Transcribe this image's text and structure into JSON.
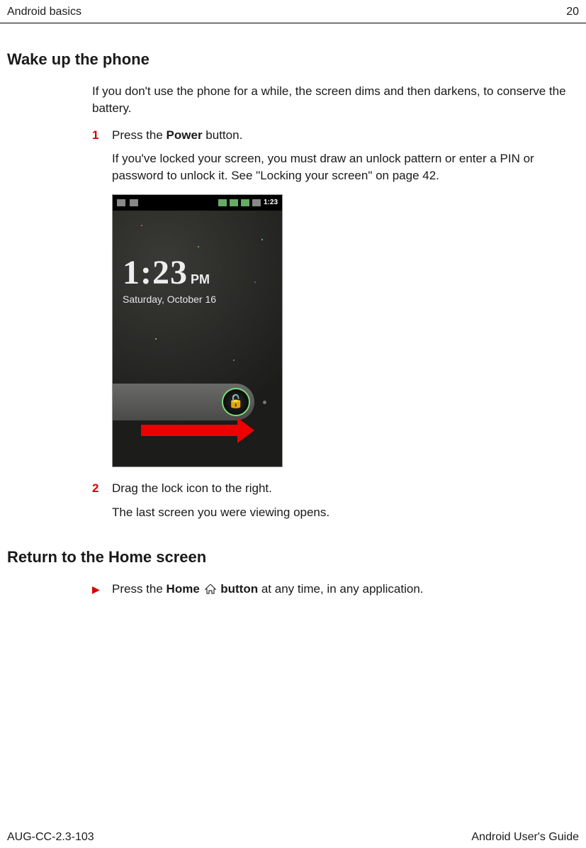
{
  "header": {
    "left": "Android basics",
    "right": "20"
  },
  "section1": {
    "title": "Wake up the phone",
    "intro": "If you don't use the phone for a while, the screen dims and then darkens, to conserve the battery.",
    "steps": [
      {
        "num": "1",
        "prefix": "Press the ",
        "bold": "Power",
        "suffix": " button.",
        "follow": "If you've locked your screen, you must draw an unlock pattern or enter a PIN or password to unlock it. See \"Locking your screen\" on page 42."
      },
      {
        "num": "2",
        "text": "Drag the lock icon to the right.",
        "follow": "The last screen you were viewing opens."
      }
    ]
  },
  "screenshot": {
    "status_time": "1:23",
    "clock_time": "1:23",
    "clock_period": "PM",
    "clock_date": "Saturday, October 16"
  },
  "section2": {
    "title": "Return to the Home screen",
    "bullet": "▶",
    "prefix": "Press the ",
    "bold1": "Home",
    "bold2": " button",
    "suffix": " at any time, in any application."
  },
  "footer": {
    "left": "AUG-CC-2.3-103",
    "right": "Android User's Guide"
  }
}
